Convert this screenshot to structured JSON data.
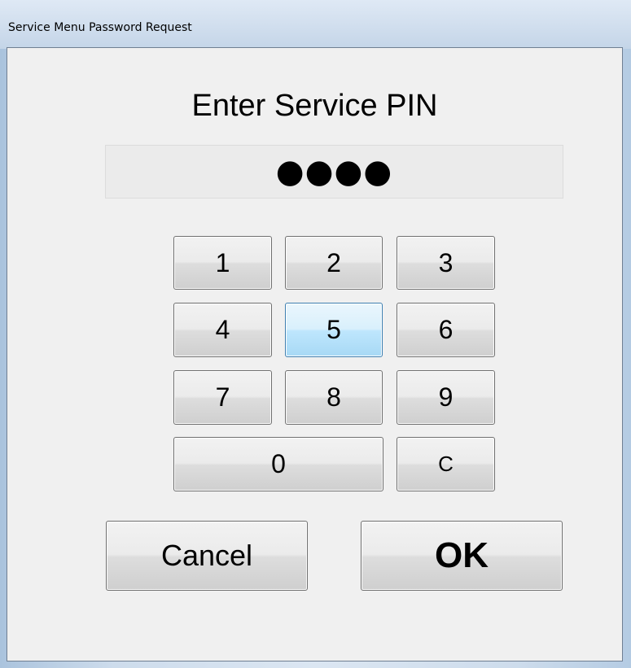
{
  "window": {
    "title": "Service Menu Password Request"
  },
  "dialog": {
    "heading": "Enter Service PIN",
    "pin_masked": "●●●●",
    "keypad": {
      "k1": "1",
      "k2": "2",
      "k3": "3",
      "k4": "4",
      "k5": "5",
      "k6": "6",
      "k7": "7",
      "k8": "8",
      "k9": "9",
      "k0": "0",
      "clear": "C"
    },
    "focused_key": "5",
    "cancel_label": "Cancel",
    "ok_label": "OK"
  },
  "colors": {
    "client_background": "#f0f0f0",
    "focus_border": "#3c7fb1",
    "focus_fill": "#bee6fd"
  }
}
